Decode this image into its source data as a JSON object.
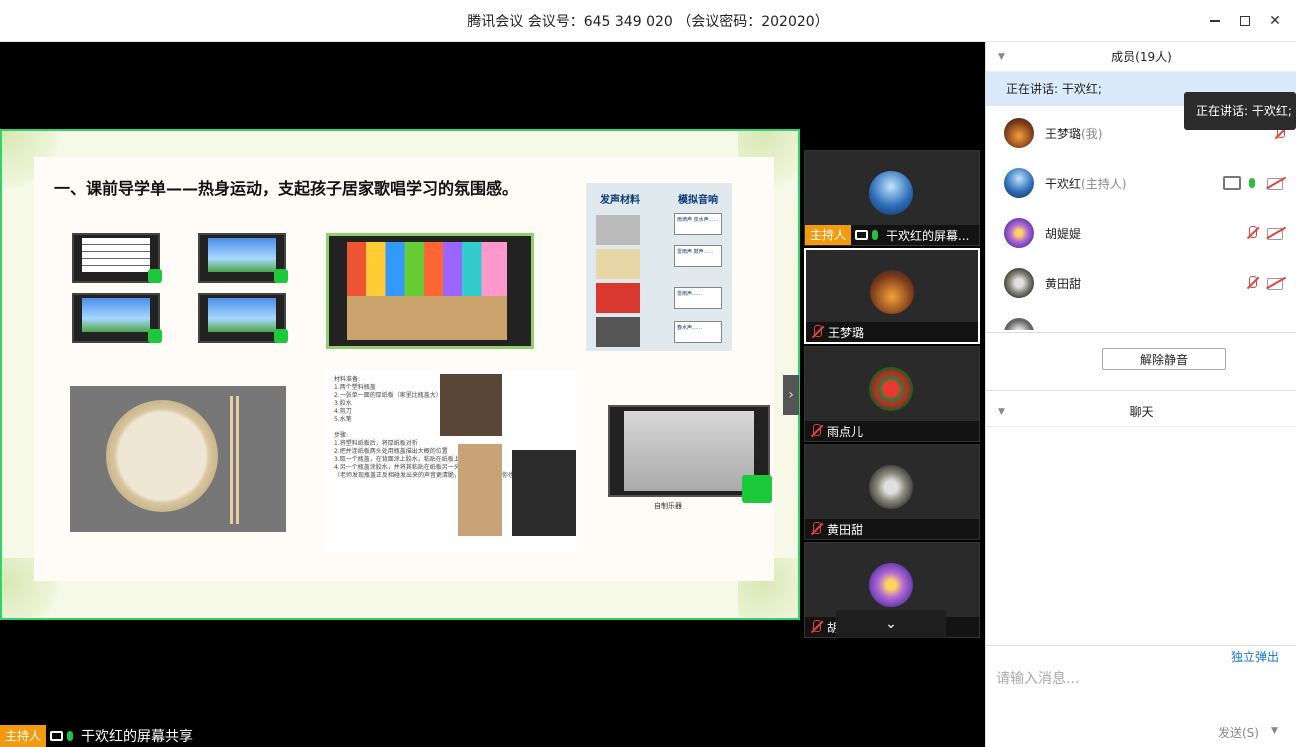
{
  "window": {
    "title": "腾讯会议 会议号：645 349 020 （会议密码：202020）"
  },
  "share": {
    "slide_title": "一、课前导学单——热身运动，支起孩子居家歌唱学习的氛围感。",
    "host_badge": "主持人",
    "sharer_name": "干欢红的屏幕共享",
    "video_caption": "自制乐器",
    "material_header_left": "发声材料",
    "material_header_right": "模拟音响",
    "material_tags": [
      "雨滴声 泉水声……",
      "雷雨声 鼓声……",
      "雷雨声……",
      "春水声……"
    ],
    "materials_text": "材料准备:\n1.两个塑料瓶盖\n2.一张单一面的厚纸板（家里比瓶盖大）\n3.胶水\n4.剪刀\n5.水笔\n\n步骤:\n1.将塑料纸板后，将厚纸板对折\n2.把并连纸板两头处用瓶盖描出大概的位置\n3.取一个瓶盖，在背面涂上胶水，粘贴在纸板上\n4.另一个瓶盖涂胶水，并将其粘贴在纸板另一头。（成品如图）\n（老师发现瓶盖正反相碰发出来的声音更清脆，所以这样粘贴，你也可以试试）"
  },
  "tiles": [
    {
      "name": "干欢红的屏幕...",
      "host": true,
      "badge": "主持人"
    },
    {
      "name": "王梦璐"
    },
    {
      "name": "雨点儿"
    },
    {
      "name": "黄田甜"
    },
    {
      "name": "胡媞媞"
    }
  ],
  "panel": {
    "members_header": "成员(19人)",
    "speaking": "正在讲话: 干欢红;",
    "tooltip": "正在讲话: 干欢红;",
    "members": [
      {
        "name": "王梦璐",
        "role": "(我)"
      },
      {
        "name": "干欢红",
        "role": "(主持人)"
      },
      {
        "name": "胡媞媞",
        "role": ""
      },
      {
        "name": "黄田甜",
        "role": ""
      }
    ],
    "unmute_label": "解除静音",
    "chat_header": "聊天",
    "popout_label": "独立弹出",
    "input_placeholder": "请输入消息...",
    "send_label": "发送(S)"
  },
  "colors": {
    "accent_green": "#2fd36a",
    "host_orange": "#f29b11",
    "link_blue": "#1a73d6",
    "muted_red": "#e0443e"
  }
}
